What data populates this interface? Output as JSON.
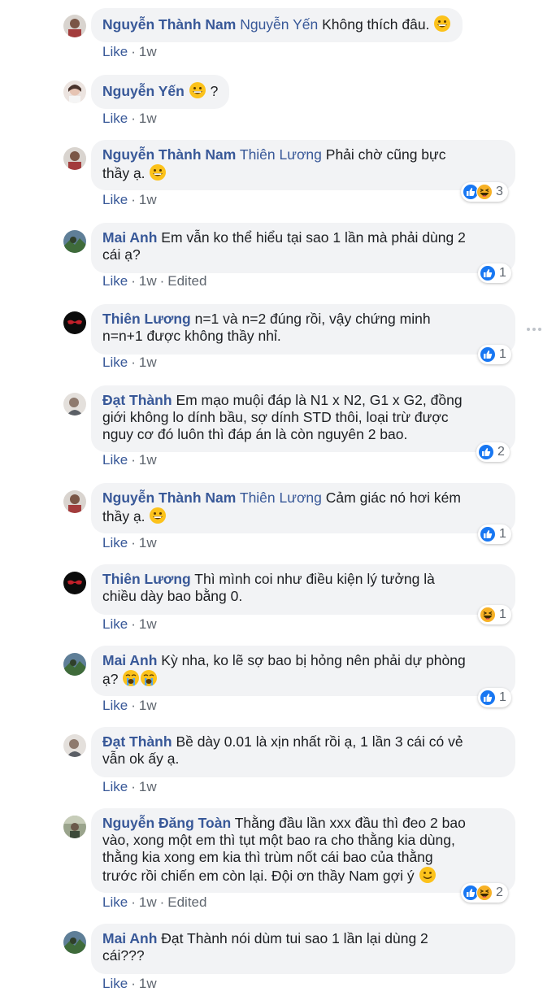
{
  "comments": [
    {
      "author": "Nguyễn Thành Nam",
      "mention": "Nguyễn Yến",
      "text_lines": [
        "Không thích đâu."
      ],
      "trailing_emoji": "grinning-emoji",
      "actions": {
        "like": "Like",
        "time": "1w",
        "edited": ""
      },
      "reactions": null
    },
    {
      "author": "Nguyễn Yến",
      "mention": "",
      "text_lines": [
        "?"
      ],
      "leading_emoji": "grinning-emoji",
      "actions": {
        "like": "Like",
        "time": "1w",
        "edited": ""
      },
      "reactions": null
    },
    {
      "author": "Nguyễn Thành Nam",
      "mention": "Thiên Lương",
      "text_lines": [
        "Phải chờ cũng bực",
        "thầy ạ."
      ],
      "trailing_emoji": "grinning-emoji",
      "actions": {
        "like": "Like",
        "time": "1w",
        "edited": ""
      },
      "reactions": {
        "icons": [
          "like-reaction-icon",
          "haha-reaction-icon"
        ],
        "count": "3"
      }
    },
    {
      "author": "Mai Anh",
      "mention": "",
      "text_lines": [
        "Em vẫn ko thể hiểu tại sao 1 lần mà phải dùng 2",
        "cái ạ?"
      ],
      "actions": {
        "like": "Like",
        "time": "1w",
        "edited": "Edited"
      },
      "reactions": {
        "icons": [
          "like-reaction-icon"
        ],
        "count": "1"
      }
    },
    {
      "author": "Thiên Lương",
      "mention": "",
      "text_lines": [
        "n=1 và n=2 đúng rồi, vậy chứng minh",
        "n=n+1 được không thầy nhỉ."
      ],
      "actions": {
        "like": "Like",
        "time": "1w",
        "edited": ""
      },
      "reactions": {
        "icons": [
          "like-reaction-icon"
        ],
        "count": "1"
      }
    },
    {
      "author": "Đạt Thành",
      "mention": "",
      "text_lines": [
        "Em mạo muội đáp là N1 x N2, G1 x G2, đồng",
        "giới không lo dính bầu, sợ dính STD thôi, loại trừ được",
        "nguy cơ đó luôn thì đáp án là còn nguyên 2 bao."
      ],
      "actions": {
        "like": "Like",
        "time": "1w",
        "edited": ""
      },
      "reactions": {
        "icons": [
          "like-reaction-icon"
        ],
        "count": "2"
      }
    },
    {
      "author": "Nguyễn Thành Nam",
      "mention": "Thiên Lương",
      "text_lines": [
        "Cảm giác nó hơi kém",
        "thầy ạ."
      ],
      "trailing_emoji": "grinning-emoji",
      "actions": {
        "like": "Like",
        "time": "1w",
        "edited": ""
      },
      "reactions": {
        "icons": [
          "like-reaction-icon"
        ],
        "count": "1"
      }
    },
    {
      "author": "Thiên Lương",
      "mention": "",
      "text_lines": [
        "Thì mình coi như điều kiện lý tưởng là",
        "chiều dày bao bằng 0."
      ],
      "actions": {
        "like": "Like",
        "time": "1w",
        "edited": ""
      },
      "reactions": {
        "icons": [
          "haha-reaction-icon"
        ],
        "count": "1"
      }
    },
    {
      "author": "Mai Anh",
      "mention": "",
      "text_lines": [
        "Kỳ nha, ko lẽ sợ bao bị hỏng nên phải dự phòng",
        "ạ?"
      ],
      "trailing_emoji": "crying-emoji-pair",
      "actions": {
        "like": "Like",
        "time": "1w",
        "edited": ""
      },
      "reactions": {
        "icons": [
          "like-reaction-icon"
        ],
        "count": "1"
      }
    },
    {
      "author": "Đạt Thành",
      "mention": "",
      "text_lines": [
        "Bề dày 0.01 là xịn nhất rồi ạ, 1 lần 3 cái có vẻ",
        "vẫn ok ấy ạ."
      ],
      "actions": {
        "like": "Like",
        "time": "1w",
        "edited": ""
      },
      "reactions": null
    },
    {
      "author": "Nguyễn Đăng Toàn",
      "mention": "",
      "text_lines": [
        "Thằng đầu lần xxx đầu thì đeo 2 bao",
        "vào, xong một em thì tụt một bao ra cho thằng kia dùng,",
        "thằng kia xong em kia thì trùm nốt cái bao của thằng",
        "trước rồi chiến em còn lại. Đội ơn thầy Nam gợi ý"
      ],
      "trailing_emoji": "smiling-emoji",
      "actions": {
        "like": "Like",
        "time": "1w",
        "edited": "Edited"
      },
      "reactions": {
        "icons": [
          "like-reaction-icon",
          "haha-reaction-icon"
        ],
        "count": "2"
      }
    },
    {
      "author": "Mai Anh",
      "mention": "",
      "text_lines": [
        "Đạt Thành nói dùm tui sao 1 lần lại dùng 2",
        "cái???"
      ],
      "actions": {
        "like": "Like",
        "time": "1w",
        "edited": ""
      },
      "reactions": null
    }
  ],
  "colors": {
    "author": "#385898",
    "bubble": "#f2f3f5",
    "like_blue": "#1877f2",
    "haha_yellow": "#f7b125"
  },
  "icons": {
    "more_options": "more-options-icon"
  }
}
